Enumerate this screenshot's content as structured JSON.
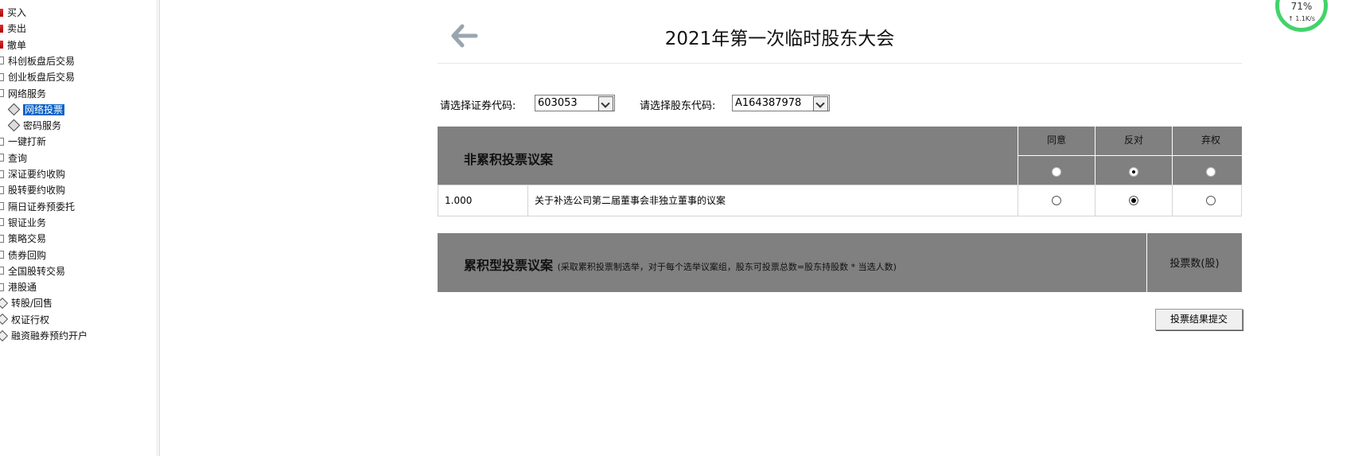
{
  "tree": {
    "items": [
      {
        "label": "买入",
        "icon": "buy-icon",
        "selected": false
      },
      {
        "label": "卖出",
        "icon": "sell-icon",
        "selected": false
      },
      {
        "label": "撤单",
        "icon": "cancel-order-icon",
        "selected": false
      },
      {
        "label": "科创板盘后交易",
        "icon": "folder-icon",
        "selected": false
      },
      {
        "label": "创业板盘后交易",
        "icon": "folder-icon",
        "selected": false
      },
      {
        "label": "网络服务",
        "icon": "folder-icon",
        "selected": false
      },
      {
        "label": "网络投票",
        "icon": "diamond-icon",
        "selected": true
      },
      {
        "label": "密码服务",
        "icon": "diamond-icon",
        "selected": false
      },
      {
        "label": "一键打新",
        "icon": "folder-icon",
        "selected": false
      },
      {
        "label": "查询",
        "icon": "folder-icon",
        "selected": false
      },
      {
        "label": "深证要约收购",
        "icon": "folder-icon",
        "selected": false
      },
      {
        "label": "股转要约收购",
        "icon": "folder-icon",
        "selected": false
      },
      {
        "label": "隔日证券预委托",
        "icon": "folder-icon",
        "selected": false
      },
      {
        "label": "银证业务",
        "icon": "folder-icon",
        "selected": false
      },
      {
        "label": "策略交易",
        "icon": "folder-icon",
        "selected": false
      },
      {
        "label": "债券回购",
        "icon": "folder-icon",
        "selected": false
      },
      {
        "label": "全国股转交易",
        "icon": "folder-icon",
        "selected": false
      },
      {
        "label": "港股通",
        "icon": "folder-icon",
        "selected": false
      },
      {
        "label": "转股/回售",
        "icon": "diamond-icon",
        "selected": false
      },
      {
        "label": "权证行权",
        "icon": "diamond-icon",
        "selected": false
      },
      {
        "label": "融资融券预约开户",
        "icon": "diamond-icon",
        "selected": false
      }
    ]
  },
  "header": {
    "title": "2021年第一次临时股东大会"
  },
  "filters": {
    "security_label": "请选择证券代码:",
    "security_value": "603053",
    "holder_label": "请选择股东代码:",
    "holder_value": "A164387978"
  },
  "noncumulative": {
    "title": "非累积投票议案",
    "columns": [
      "同意",
      "反对",
      "弃权"
    ],
    "header_choice": "反对",
    "rows": [
      {
        "no": "1.000",
        "text": "关于补选公司第二届董事会非独立董事的议案",
        "choice": "反对"
      }
    ]
  },
  "cumulative": {
    "title": "累积型投票议案",
    "note": "(采取累积投票制选举，对于每个选举议案组，股东可投票总数=股东持股数 * 当选人数)",
    "column": "投票数(股)"
  },
  "submit_label": "投票结果提交",
  "speed_widget": {
    "percent": "71%",
    "rate": "↑ 1.1K/s"
  }
}
